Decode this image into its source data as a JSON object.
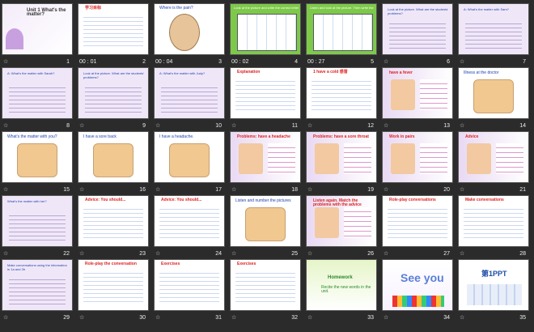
{
  "slides": [
    {
      "n": "1",
      "meta": "",
      "title": "Unit 1 What's the matter?",
      "kind": "title"
    },
    {
      "n": "2",
      "meta": "00 : 01",
      "title": "学习目标",
      "kind": "text"
    },
    {
      "n": "3",
      "meta": "00 : 04",
      "title": "Where is the pain?",
      "kind": "face"
    },
    {
      "n": "4",
      "meta": "00 : 02",
      "title": "Look at the picture and write the correct letter",
      "kind": "table"
    },
    {
      "n": "5",
      "meta": "00 : 27",
      "title": "Listen and look at the picture. Then write the",
      "kind": "table"
    },
    {
      "n": "6",
      "meta": "",
      "title": "Look at the picture. What are the students' problems?",
      "kind": "dialog"
    },
    {
      "n": "7",
      "meta": "",
      "title": "A: What's the matter with Sam?",
      "kind": "dialog"
    },
    {
      "n": "8",
      "meta": "",
      "title": "A: What's the matter with Sarah?",
      "kind": "dialog"
    },
    {
      "n": "9",
      "meta": "",
      "title": "Look at the picture. What are the students' problems?",
      "kind": "dialog"
    },
    {
      "n": "10",
      "meta": "",
      "title": "A: What's the matter with Judy?",
      "kind": "dialog"
    },
    {
      "n": "11",
      "meta": "",
      "title": "Explanation",
      "kind": "text"
    },
    {
      "n": "12",
      "meta": "",
      "title": "1 have a cold 感冒",
      "kind": "text"
    },
    {
      "n": "13",
      "meta": "",
      "title": "have a fever",
      "kind": "list"
    },
    {
      "n": "14",
      "meta": "",
      "title": "Illness at the doctor",
      "kind": "pic"
    },
    {
      "n": "15",
      "meta": "",
      "title": "What's the matter with you?",
      "kind": "pic"
    },
    {
      "n": "16",
      "meta": "",
      "title": "I have a sore back",
      "kind": "pic"
    },
    {
      "n": "17",
      "meta": "",
      "title": "I have a headache.",
      "kind": "pic"
    },
    {
      "n": "18",
      "meta": "",
      "title": "Problems: have a headache",
      "kind": "list"
    },
    {
      "n": "19",
      "meta": "",
      "title": "Problems: have a sore throat",
      "kind": "list"
    },
    {
      "n": "20",
      "meta": "",
      "title": "Work in pairs",
      "kind": "list"
    },
    {
      "n": "21",
      "meta": "",
      "title": "Advice",
      "kind": "list"
    },
    {
      "n": "22",
      "meta": "",
      "title": "What's the matter with her?",
      "kind": "dialog"
    },
    {
      "n": "23",
      "meta": "",
      "title": "Advice: You should...",
      "kind": "text"
    },
    {
      "n": "24",
      "meta": "",
      "title": "Advice: You should...",
      "kind": "text"
    },
    {
      "n": "25",
      "meta": "",
      "title": "Listen and number the pictures",
      "kind": "pic"
    },
    {
      "n": "26",
      "meta": "",
      "title": "Listen again. Match the problems with the advice",
      "kind": "list"
    },
    {
      "n": "27",
      "meta": "",
      "title": "Role-play conversations",
      "kind": "text"
    },
    {
      "n": "28",
      "meta": "",
      "title": "Make conversations",
      "kind": "text"
    },
    {
      "n": "29",
      "meta": "",
      "title": "Make conversations using the information in 1a and 2b",
      "kind": "dialog"
    },
    {
      "n": "30",
      "meta": "",
      "title": "Role-play the conversation",
      "kind": "text"
    },
    {
      "n": "31",
      "meta": "",
      "title": "Exercises",
      "kind": "text"
    },
    {
      "n": "32",
      "meta": "",
      "title": "Exercises",
      "kind": "text"
    },
    {
      "n": "33",
      "meta": "",
      "title": "Homework",
      "kind": "homework",
      "sub": "Recite the new words in the unit."
    },
    {
      "n": "34",
      "meta": "",
      "title": "See you",
      "kind": "seeyou"
    },
    {
      "n": "35",
      "meta": "",
      "title": "第1PPT",
      "kind": "brand"
    }
  ]
}
